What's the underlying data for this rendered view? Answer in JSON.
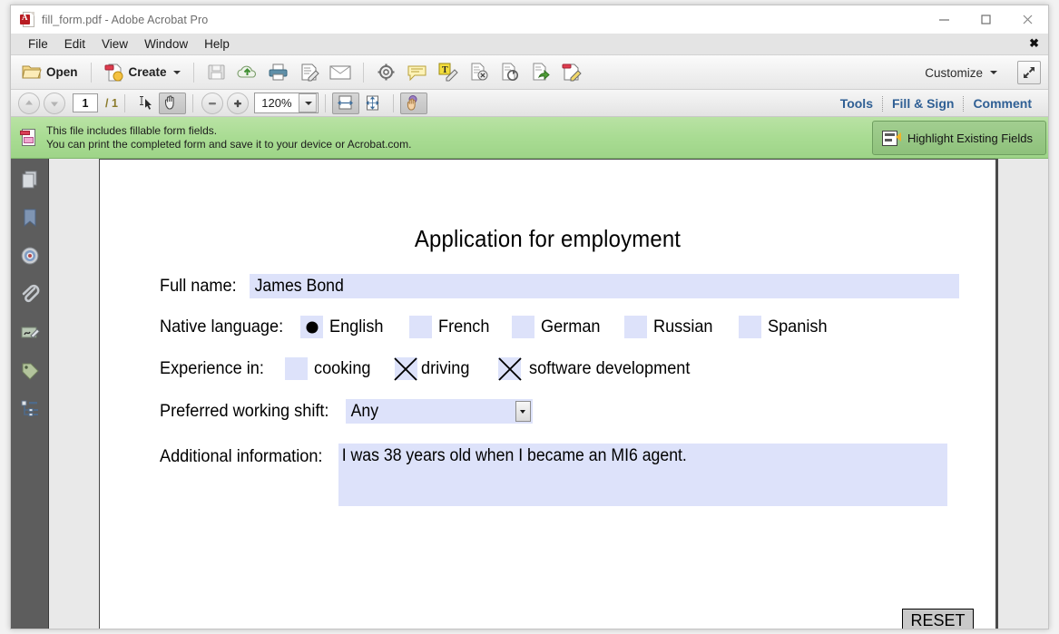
{
  "window": {
    "title": "fill_form.pdf - Adobe Acrobat Pro",
    "app_icon": "pdf-file-icon",
    "minimize_label": "–",
    "maximize_label": "□",
    "close_label": "✕"
  },
  "menubar": {
    "items": [
      {
        "label": "File"
      },
      {
        "label": "Edit"
      },
      {
        "label": "View"
      },
      {
        "label": "Window"
      },
      {
        "label": "Help"
      }
    ],
    "close_ribbon_label": "✖"
  },
  "toolbar": {
    "open_label": "Open",
    "create_label": "Create",
    "customize_label": "Customize",
    "icons": [
      {
        "name": "save-icon",
        "title": "Save"
      },
      {
        "name": "cloud-upload-icon",
        "title": "Send to Cloud"
      },
      {
        "name": "print-icon",
        "title": "Print File"
      },
      {
        "name": "sign-document-icon",
        "title": "Sign"
      },
      {
        "name": "email-icon",
        "title": "Email"
      },
      {
        "name": "gear-icon",
        "title": "Settings"
      },
      {
        "name": "comment-bubble-icon",
        "title": "Add Sticky Note"
      },
      {
        "name": "highlight-text-icon",
        "title": "Highlight Text"
      },
      {
        "name": "delete-page-icon",
        "title": "Delete Page"
      },
      {
        "name": "rotate-page-icon",
        "title": "Rotate Page"
      },
      {
        "name": "export-page-icon",
        "title": "Export"
      },
      {
        "name": "edit-document-icon",
        "title": "Edit Document"
      }
    ]
  },
  "navbar": {
    "current_page": "1",
    "total_pages": "/ 1",
    "zoom_value": "120%",
    "select_tool": "select-cursor-icon",
    "hand_tool": "hand-tool-icon",
    "zoom_out": "zoom-out-icon",
    "zoom_in": "zoom-in-icon",
    "fit_width": "fit-width-icon",
    "fit_page": "fit-page-icon",
    "pan_active": "pan-and-zoom-icon",
    "links": [
      {
        "label": "Tools"
      },
      {
        "label": "Fill & Sign"
      },
      {
        "label": "Comment"
      }
    ]
  },
  "notification": {
    "line1": "This file includes fillable form fields.",
    "line2": "You can print the completed form and save it to your device or Acrobat.com.",
    "button_label": "Highlight Existing Fields",
    "icon": "form-fields-icon",
    "bg_color": "#a9dc93"
  },
  "navpane": {
    "items": [
      {
        "name": "page-thumbnails-icon",
        "title": "Page Thumbnails"
      },
      {
        "name": "bookmarks-icon",
        "title": "Bookmarks"
      },
      {
        "name": "destinations-icon",
        "title": "Destinations"
      },
      {
        "name": "attachments-icon",
        "title": "Attachments"
      },
      {
        "name": "signatures-icon",
        "title": "Signatures"
      },
      {
        "name": "tags-icon",
        "title": "Tags"
      },
      {
        "name": "content-tree-icon",
        "title": "Content"
      }
    ]
  },
  "form": {
    "title": "Application for employment",
    "field_bg_color": "#dde2fa",
    "full_name": {
      "label": "Full name:",
      "value": "James Bond"
    },
    "native_language": {
      "label": "Native language:",
      "selected": "English",
      "options": [
        {
          "label": "English",
          "checked": true
        },
        {
          "label": "French",
          "checked": false
        },
        {
          "label": "German",
          "checked": false
        },
        {
          "label": "Russian",
          "checked": false
        },
        {
          "label": "Spanish",
          "checked": false
        }
      ]
    },
    "experience": {
      "label": "Experience in:",
      "options": [
        {
          "label": "cooking",
          "checked": false
        },
        {
          "label": "driving",
          "checked": true
        },
        {
          "label": "software development",
          "checked": true
        }
      ]
    },
    "shift": {
      "label": "Preferred working shift:",
      "value": "Any"
    },
    "additional": {
      "label": "Additional information:",
      "value": "I was 38 years old when I became an MI6 agent."
    },
    "reset_label": "RESET"
  }
}
